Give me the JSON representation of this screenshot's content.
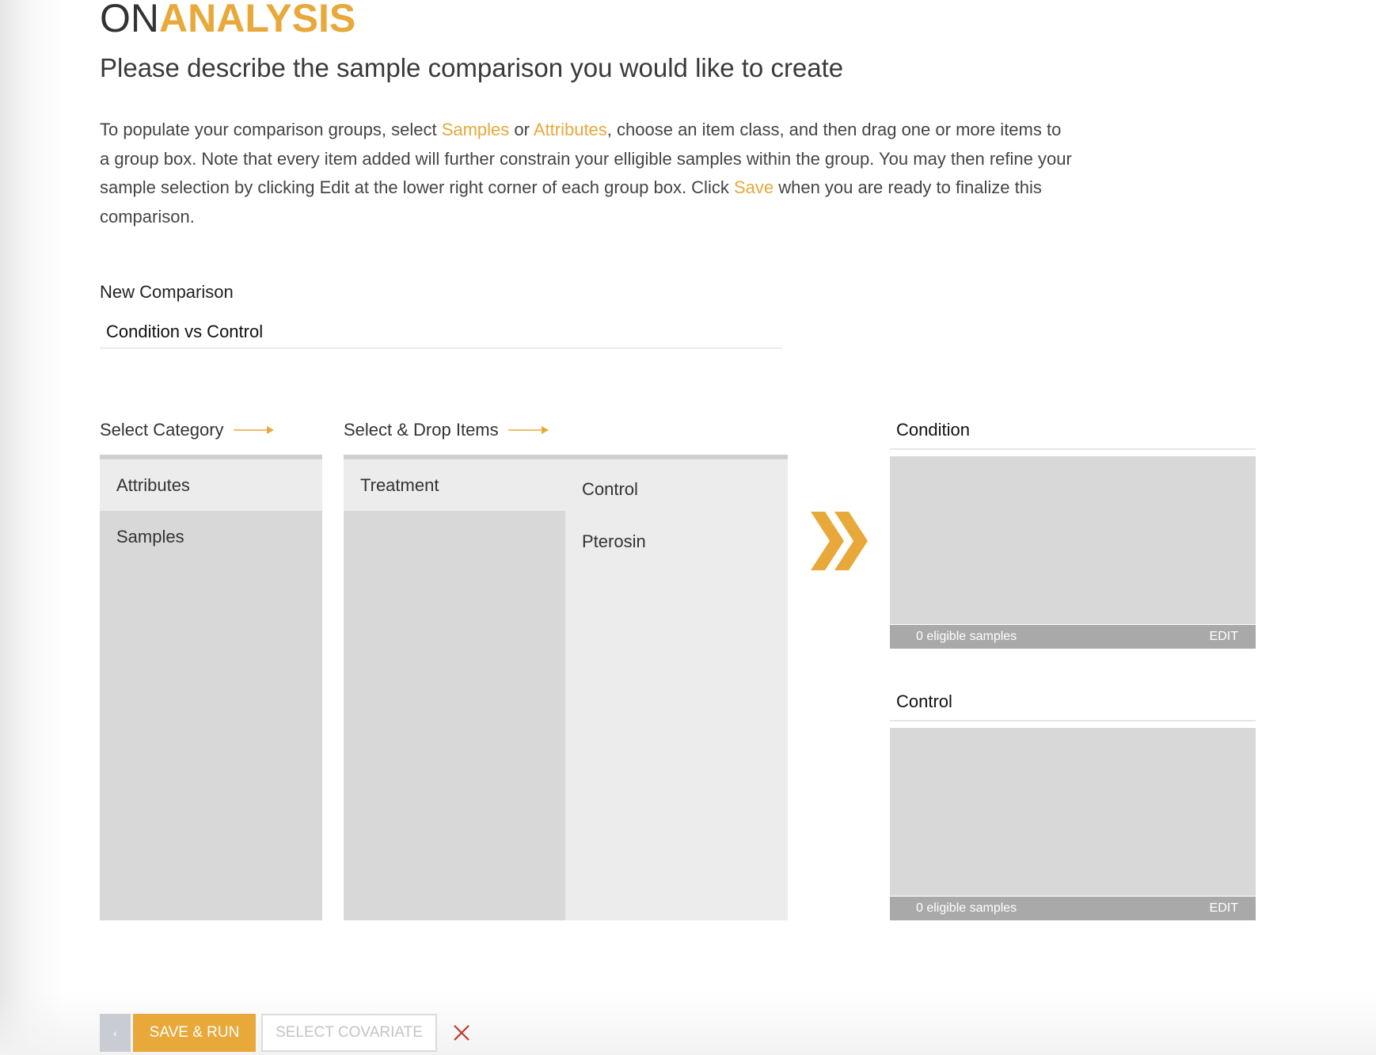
{
  "brand": {
    "prefix": "ON",
    "suffix": "ANALYSIS"
  },
  "headline": "Please describe the sample comparison you would like to create",
  "intro": {
    "part1": "To populate your comparison groups, select ",
    "samples_link": "Samples",
    "part2": " or ",
    "attributes_link": "Attributes",
    "part3": ", choose an item class, and then drag one or more items to a group box. Note that every item added will further constrain your elligible samples within the group. You may then refine your sample selection by clicking Edit at the lower right corner of each group box. Click ",
    "save_link": "Save",
    "part4": " when you are ready to finalize this comparison."
  },
  "comparison": {
    "label": "New Comparison",
    "value": "Condition vs Control"
  },
  "category": {
    "heading": "Select Category",
    "items": [
      "Attributes",
      "Samples"
    ],
    "selected": "Attributes"
  },
  "drop_items": {
    "heading": "Select & Drop Items",
    "classes": [
      "Treatment"
    ],
    "values": [
      "Control",
      "Pterosin"
    ]
  },
  "groups": [
    {
      "title": "Condition",
      "eligible": "0 eligible samples",
      "edit_label": "EDIT"
    },
    {
      "title": "Control",
      "eligible": "0 eligible samples",
      "edit_label": "EDIT"
    }
  ],
  "footer": {
    "back_label": "‹",
    "save_run_label": "SAVE & RUN",
    "select_covariate_label": "SELECT COVARIATE"
  },
  "colors": {
    "accent": "#e8a83a",
    "panel_gray": "#d8d8d8",
    "panel_light": "#ececec",
    "footer_gray": "#a9a9a9",
    "close_red": "#c0392b"
  },
  "icons": {
    "heading_arrow": "arrow-right-icon",
    "transfer": "double-chevron-right-icon",
    "close": "close-x-icon"
  }
}
